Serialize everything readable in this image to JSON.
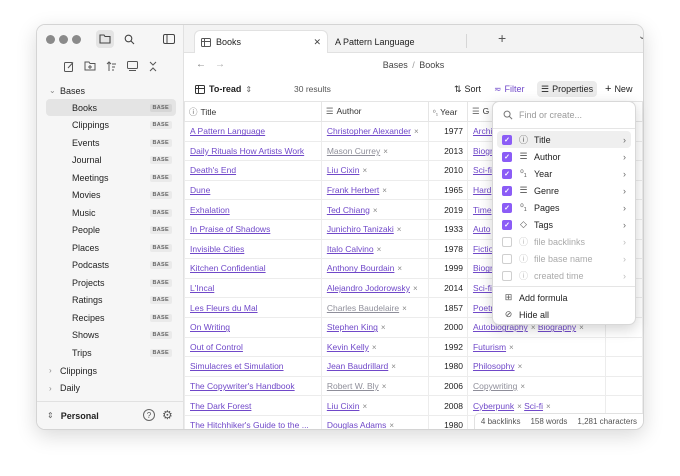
{
  "sidebar": {
    "sections": [
      {
        "label": "Bases"
      },
      {
        "label": "Clippings"
      },
      {
        "label": "Daily"
      }
    ],
    "items": [
      {
        "label": "Books",
        "badge": "BASE"
      },
      {
        "label": "Clippings",
        "badge": "BASE"
      },
      {
        "label": "Events",
        "badge": "BASE"
      },
      {
        "label": "Journal",
        "badge": "BASE"
      },
      {
        "label": "Meetings",
        "badge": "BASE"
      },
      {
        "label": "Movies",
        "badge": "BASE"
      },
      {
        "label": "Music",
        "badge": "BASE"
      },
      {
        "label": "People",
        "badge": "BASE"
      },
      {
        "label": "Places",
        "badge": "BASE"
      },
      {
        "label": "Podcasts",
        "badge": "BASE"
      },
      {
        "label": "Projects",
        "badge": "BASE"
      },
      {
        "label": "Ratings",
        "badge": "BASE"
      },
      {
        "label": "Recipes",
        "badge": "BASE"
      },
      {
        "label": "Shows",
        "badge": "BASE"
      },
      {
        "label": "Trips",
        "badge": "BASE"
      }
    ],
    "vault_name": "Personal"
  },
  "tabs": [
    {
      "label": "Books",
      "close": "✕"
    },
    {
      "label": "A Pattern Language"
    }
  ],
  "nav": {
    "breadcrumb_parent": "Bases",
    "breadcrumb_sep": "/",
    "breadcrumb_current": "Books"
  },
  "toolbar": {
    "view_name": "To-read",
    "results": "30 results",
    "sort": "Sort",
    "filter": "Filter",
    "properties": "Properties",
    "new": "New"
  },
  "table": {
    "headers": {
      "title": "Title",
      "author": "Author",
      "year": "Year",
      "genre": "G"
    },
    "rows": [
      {
        "title": "A Pattern Language",
        "author": "Christopher Alexander",
        "author_resolved": true,
        "year": "1977",
        "genre": [
          "Archi"
        ]
      },
      {
        "title": "Daily Rituals How Artists Work",
        "author": "Mason Currey",
        "author_resolved": false,
        "year": "2013",
        "genre": [
          "Biogr"
        ]
      },
      {
        "title": "Death's End",
        "author": "Liu Cixin",
        "author_resolved": true,
        "year": "2010",
        "genre": [
          "Sci-fi"
        ]
      },
      {
        "title": "Dune",
        "author": "Frank Herbert",
        "author_resolved": true,
        "year": "1965",
        "genre": [
          "Hard"
        ]
      },
      {
        "title": "Exhalation",
        "author": "Ted Chiang",
        "author_resolved": true,
        "year": "2019",
        "genre": [
          "Time"
        ]
      },
      {
        "title": "In Praise of Shadows",
        "author": "Junichiro Tanizaki",
        "author_resolved": true,
        "year": "1933",
        "genre": [
          "Auto"
        ]
      },
      {
        "title": "Invisible Cities",
        "author": "Italo Calvino",
        "author_resolved": true,
        "year": "1978",
        "genre": [
          "Fictio"
        ]
      },
      {
        "title": "Kitchen Confidential",
        "author": "Anthony Bourdain",
        "author_resolved": true,
        "year": "1999",
        "genre": [
          "Biogr"
        ]
      },
      {
        "title": "L'Incal",
        "author": "Alejandro Jodorowsky",
        "author_resolved": true,
        "year": "2014",
        "genre": [
          "Sci-fi"
        ]
      },
      {
        "title": "Les Fleurs du Mal",
        "author": "Charles Baudelaire",
        "author_resolved": false,
        "year": "1857",
        "genre": [
          "Poetr"
        ]
      },
      {
        "title": "On Writing",
        "author": "Stephen King",
        "author_resolved": true,
        "year": "2000",
        "genre": [
          "Autobiography",
          "Biography"
        ]
      },
      {
        "title": "Out of Control",
        "author": "Kevin Kelly",
        "author_resolved": true,
        "year": "1992",
        "genre": [
          "Futurism"
        ]
      },
      {
        "title": "Simulacres et Simulation",
        "author": "Jean Baudrillard",
        "author_resolved": true,
        "year": "1980",
        "genre": [
          "Philosophy"
        ]
      },
      {
        "title": "The Copywriter's Handbook",
        "author": "Robert W. Bly",
        "author_resolved": false,
        "year": "2006",
        "genre": [
          "Copywriting"
        ],
        "genre_resolved": false
      },
      {
        "title": "The Dark Forest",
        "author": "Liu Cixin",
        "author_resolved": true,
        "year": "2008",
        "genre": [
          "Cyberpunk",
          "Sci-fi"
        ]
      },
      {
        "title": "The Hitchhiker's Guide to the ...",
        "author": "Douglas Adams",
        "author_resolved": true,
        "year": "1980",
        "genre": []
      }
    ]
  },
  "status": {
    "backlinks": "4 backlinks",
    "words": "158 words",
    "chars": "1,281 characters"
  },
  "properties_menu": {
    "search_placeholder": "Find or create...",
    "items": [
      {
        "label": "Title",
        "icon": "info-icon",
        "checked": true
      },
      {
        "label": "Author",
        "icon": "list-icon",
        "checked": true
      },
      {
        "label": "Year",
        "icon": "number-icon",
        "checked": true
      },
      {
        "label": "Genre",
        "icon": "list-icon",
        "checked": true
      },
      {
        "label": "Pages",
        "icon": "number-icon",
        "checked": true
      },
      {
        "label": "Tags",
        "icon": "tag-icon",
        "checked": true
      },
      {
        "label": "file backlinks",
        "icon": "info-icon",
        "checked": false
      },
      {
        "label": "file base name",
        "icon": "info-icon",
        "checked": false
      },
      {
        "label": "created time",
        "icon": "info-icon",
        "checked": false
      }
    ],
    "add_formula": "Add formula",
    "hide_all": "Hide all"
  },
  "colors": {
    "accent": "#8b5cf6",
    "link": "#7048c9",
    "unresolved_link": "#8f8f9a"
  }
}
